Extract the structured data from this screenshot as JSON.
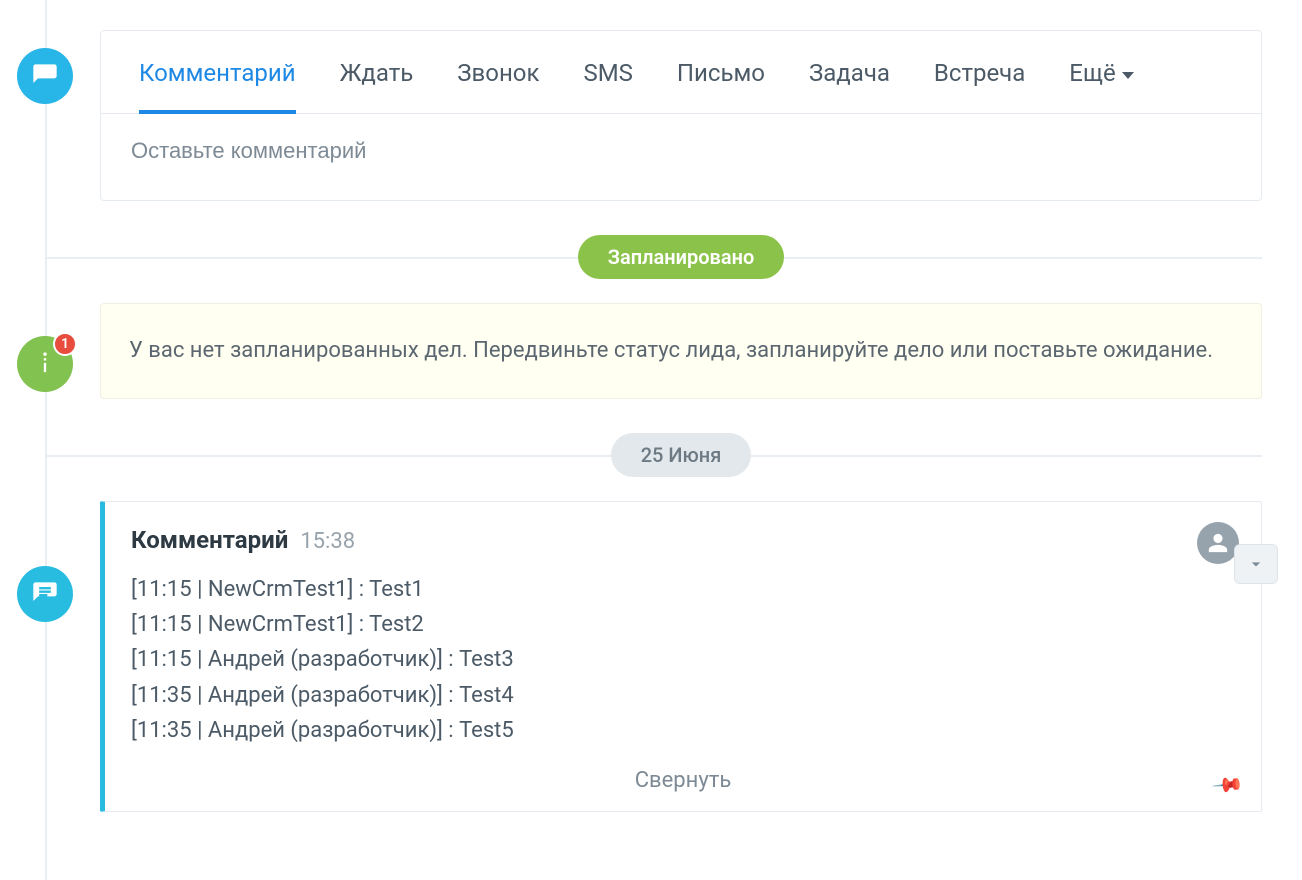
{
  "tabs": {
    "items": [
      {
        "label": "Комментарий",
        "active": true
      },
      {
        "label": "Ждать"
      },
      {
        "label": "Звонок"
      },
      {
        "label": "SMS"
      },
      {
        "label": "Письмо"
      },
      {
        "label": "Задача"
      },
      {
        "label": "Встреча"
      }
    ],
    "more_label": "Ещё"
  },
  "comment_input": {
    "placeholder": "Оставьте комментарий"
  },
  "planned_badge": "Запланировано",
  "info_badge_count": "1",
  "notice_text": "У вас нет запланированных дел. Передвиньте статус лида, запланируйте дело или поставьте ожидание.",
  "date_badge": "25 Июня",
  "comment_entry": {
    "title": "Комментарий",
    "time": "15:38",
    "lines": [
      "[11:15 | NewCrmTest1] : Test1",
      "[11:15 | NewCrmTest1] : Test2",
      "[11:15 | Андрей (разработчик)] : Test3",
      "[11:35 | Андрей (разработчик)] : Test4",
      "[11:35 | Андрей (разработчик)] : Test5"
    ],
    "collapse_label": "Свернуть"
  }
}
